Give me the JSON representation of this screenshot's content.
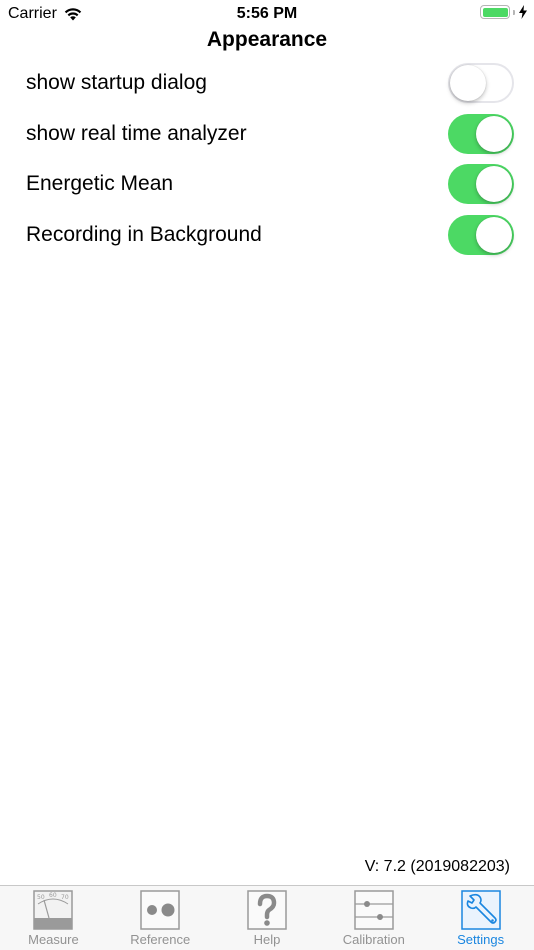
{
  "status_bar": {
    "carrier": "Carrier",
    "time": "5:56 PM",
    "battery_color": "#4cd964"
  },
  "header": {
    "title": "Appearance"
  },
  "settings": [
    {
      "label": "show startup dialog",
      "enabled": false
    },
    {
      "label": "show real time analyzer",
      "enabled": true
    },
    {
      "label": "Energetic Mean",
      "enabled": true
    },
    {
      "label": "Recording in Background",
      "enabled": true
    }
  ],
  "footer": {
    "version": "V: 7.2 (2019082203)"
  },
  "tab_bar": {
    "active_color": "#1a86e0",
    "inactive_color": "#929292",
    "tabs": [
      {
        "label": "Measure",
        "icon": "meter-gauge-icon",
        "active": false
      },
      {
        "label": "Reference",
        "icon": "two-dots-icon",
        "active": false
      },
      {
        "label": "Help",
        "icon": "question-mark-icon",
        "active": false
      },
      {
        "label": "Calibration",
        "icon": "sliders-icon",
        "active": false
      },
      {
        "label": "Settings",
        "icon": "wrench-icon",
        "active": true
      }
    ],
    "gauge_scale": [
      "50",
      "60",
      "70"
    ]
  }
}
